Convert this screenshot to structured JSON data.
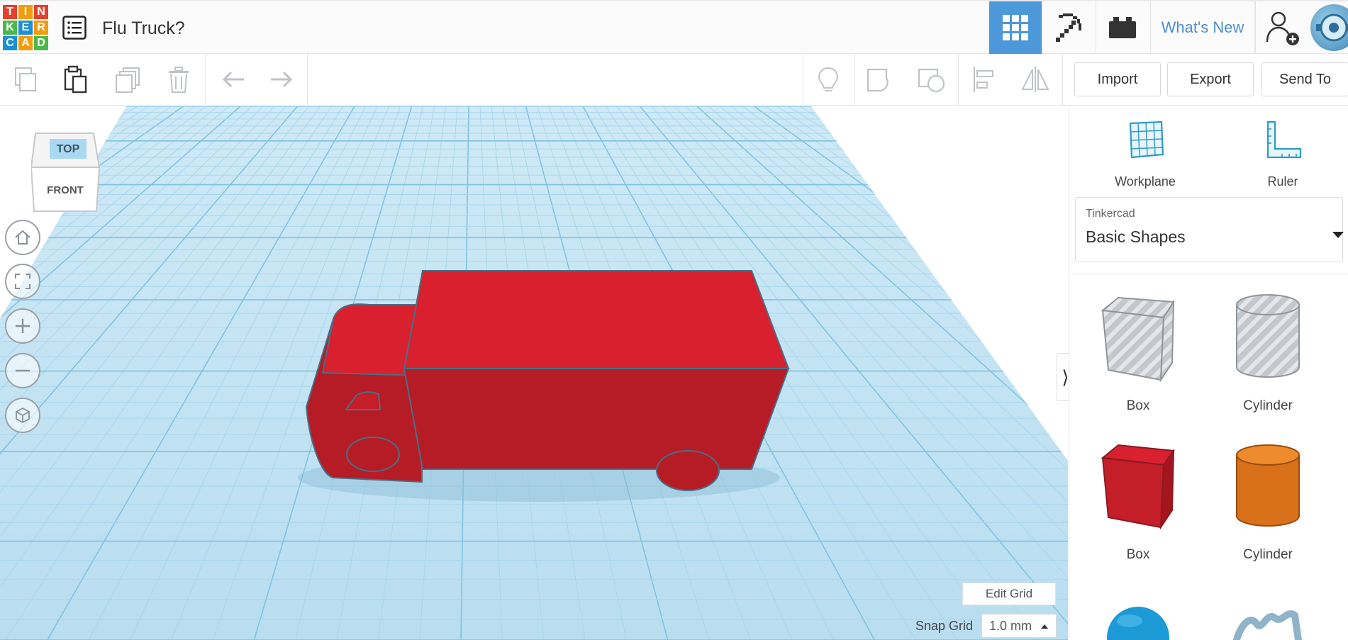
{
  "header": {
    "logo_letters": [
      "T",
      "I",
      "N",
      "K",
      "E",
      "R",
      "C",
      "A",
      "D"
    ],
    "design_title": "Flu Truck?",
    "whats_new_label": "What's New",
    "accent_color": "#4d98d8"
  },
  "toolbar": {
    "import_label": "Import",
    "export_label": "Export",
    "send_to_label": "Send To"
  },
  "workspace": {
    "view_cube": {
      "top_label": "TOP",
      "front_label": "FRONT"
    },
    "edit_grid_label": "Edit Grid",
    "snap_grid_label": "Snap Grid",
    "snap_grid_value": "1.0 mm",
    "truck_color": "#d8202e"
  },
  "right_panel": {
    "workplane_label": "Workplane",
    "ruler_label": "Ruler",
    "shape_library": {
      "category": "Tinkercad",
      "selected": "Basic Shapes"
    },
    "shapes": [
      {
        "label": "Box",
        "icon": "box-hole-icon"
      },
      {
        "label": "Cylinder",
        "icon": "cylinder-hole-icon"
      },
      {
        "label": "Box",
        "icon": "box-solid-icon"
      },
      {
        "label": "Cylinder",
        "icon": "cylinder-solid-icon"
      }
    ]
  }
}
